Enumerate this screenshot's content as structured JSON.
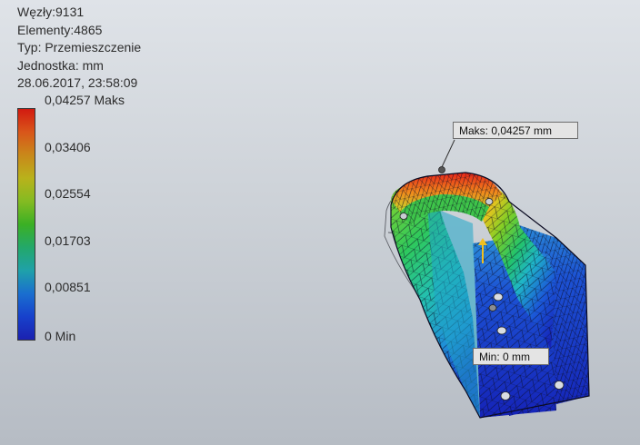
{
  "info": {
    "nodes": "Węzły:9131",
    "elements": "Elementy:4865",
    "type": "Typ: Przemieszczenie",
    "unit": "Jednostka: mm",
    "timestamp": "28.06.2017, 23:58:09"
  },
  "legend": {
    "max_label": "0,04257 Maks",
    "ticks": [
      "0,03406",
      "0,02554",
      "0,01703",
      "0,00851"
    ],
    "min_label": "0 Min",
    "colors": [
      "#d21a10",
      "#c9881a",
      "#b9b21b",
      "#3bb024",
      "#1fa1a9",
      "#1741cc",
      "#1b21b0"
    ]
  },
  "probes": {
    "max": "Maks: 0,04257 mm",
    "min": "Min: 0 mm"
  }
}
